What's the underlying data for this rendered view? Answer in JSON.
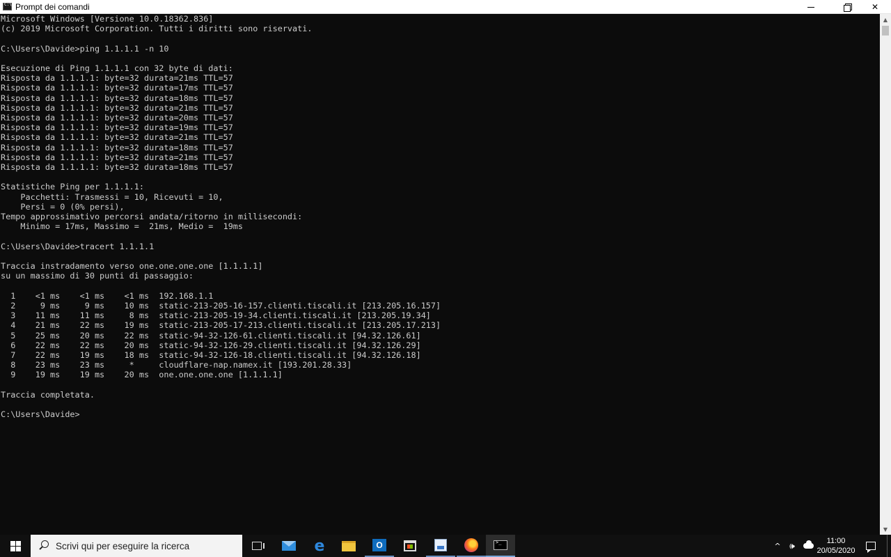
{
  "window": {
    "title": "Prompt dei comandi",
    "minimize_label": "",
    "maximize_label": "",
    "close_label": "✕"
  },
  "console": {
    "lines": [
      "Microsoft Windows [Versione 10.0.18362.836]",
      "(c) 2019 Microsoft Corporation. Tutti i diritti sono riservati.",
      "",
      "C:\\Users\\Davide>ping 1.1.1.1 -n 10",
      "",
      "Esecuzione di Ping 1.1.1.1 con 32 byte di dati:",
      "Risposta da 1.1.1.1: byte=32 durata=21ms TTL=57",
      "Risposta da 1.1.1.1: byte=32 durata=17ms TTL=57",
      "Risposta da 1.1.1.1: byte=32 durata=18ms TTL=57",
      "Risposta da 1.1.1.1: byte=32 durata=21ms TTL=57",
      "Risposta da 1.1.1.1: byte=32 durata=20ms TTL=57",
      "Risposta da 1.1.1.1: byte=32 durata=19ms TTL=57",
      "Risposta da 1.1.1.1: byte=32 durata=21ms TTL=57",
      "Risposta da 1.1.1.1: byte=32 durata=18ms TTL=57",
      "Risposta da 1.1.1.1: byte=32 durata=21ms TTL=57",
      "Risposta da 1.1.1.1: byte=32 durata=18ms TTL=57",
      "",
      "Statistiche Ping per 1.1.1.1:",
      "    Pacchetti: Trasmessi = 10, Ricevuti = 10,",
      "    Persi = 0 (0% persi),",
      "Tempo approssimativo percorsi andata/ritorno in millisecondi:",
      "    Minimo = 17ms, Massimo =  21ms, Medio =  19ms",
      "",
      "C:\\Users\\Davide>tracert 1.1.1.1",
      "",
      "Traccia instradamento verso one.one.one.one [1.1.1.1]",
      "su un massimo di 30 punti di passaggio:",
      "",
      "  1    <1 ms    <1 ms    <1 ms  192.168.1.1",
      "  2     9 ms     9 ms    10 ms  static-213-205-16-157.clienti.tiscali.it [213.205.16.157]",
      "  3    11 ms    11 ms     8 ms  static-213-205-19-34.clienti.tiscali.it [213.205.19.34]",
      "  4    21 ms    22 ms    19 ms  static-213-205-17-213.clienti.tiscali.it [213.205.17.213]",
      "  5    25 ms    20 ms    22 ms  static-94-32-126-61.clienti.tiscali.it [94.32.126.61]",
      "  6    22 ms    22 ms    20 ms  static-94-32-126-29.clienti.tiscali.it [94.32.126.29]",
      "  7    22 ms    19 ms    18 ms  static-94-32-126-18.clienti.tiscali.it [94.32.126.18]",
      "  8    23 ms    23 ms     *     cloudflare-nap.namex.it [193.201.28.33]",
      "  9    19 ms    19 ms    20 ms  one.one.one.one [1.1.1.1]",
      "",
      "Traccia completata.",
      "",
      "C:\\Users\\Davide>"
    ]
  },
  "taskbar": {
    "search_placeholder": "Scrivi qui per eseguire la ricerca",
    "outlook_letter": "O",
    "edge_letter": "e",
    "tray_chevron": "^",
    "tray_volume": "🕪",
    "clock_time": "11:00",
    "clock_date": "20/05/2020",
    "icons": [
      "start-icon",
      "search-icon",
      "task-view-icon",
      "mail-icon",
      "edge-icon",
      "file-explorer-icon",
      "outlook-icon",
      "store-icon",
      "paint-icon",
      "firefox-icon",
      "command-prompt-icon"
    ]
  },
  "colors": {
    "console_bg": "#0c0c0c",
    "console_fg": "#cccccc",
    "taskbar_bg": "#101010",
    "accent": "#7aa7d9"
  }
}
